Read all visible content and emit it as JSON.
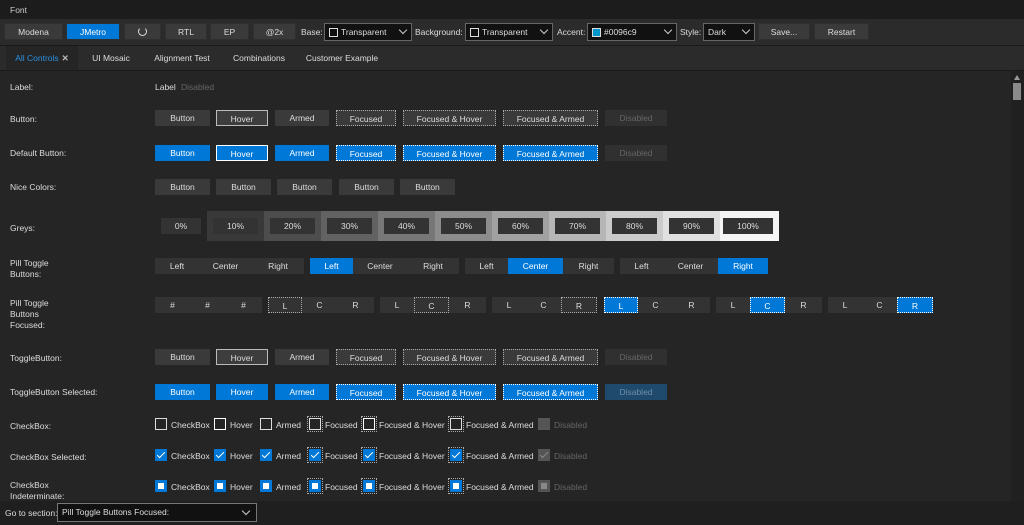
{
  "window": {
    "title": "Font"
  },
  "toolbar": {
    "modena": "Modena",
    "jmetro": "JMetro",
    "rtl": "RTL",
    "ep": "EP",
    "at2x": "@2x",
    "base_label": "Base:",
    "base_value": "Transparent",
    "background_label": "Background:",
    "background_value": "Transparent",
    "accent_label": "Accent:",
    "accent_value": "#0096c9",
    "accent_color": "#0096c9",
    "style_label": "Style:",
    "style_value": "Dark",
    "save": "Save...",
    "restart": "Restart"
  },
  "tabs": [
    "All Controls",
    "UI Mosaic",
    "Alignment Test",
    "Combinations",
    "Customer Example"
  ],
  "rows": {
    "label": {
      "title": "Label:",
      "items": [
        "Label",
        "Disabled"
      ]
    },
    "button": {
      "title": "Button:",
      "items": [
        "Button",
        "Hover",
        "Armed",
        "Focused",
        "Focused & Hover",
        "Focused & Armed",
        "Disabled"
      ]
    },
    "default_button": {
      "title": "Default Button:",
      "items": [
        "Button",
        "Hover",
        "Armed",
        "Focused",
        "Focused & Hover",
        "Focused & Armed",
        "Disabled"
      ]
    },
    "nice_colors": {
      "title": "Nice Colors:",
      "items": [
        "Button",
        "Button",
        "Button",
        "Button",
        "Button"
      ]
    },
    "greys": {
      "title": "Greys:",
      "items": [
        "0%",
        "10%",
        "20%",
        "30%",
        "40%",
        "50%",
        "60%",
        "70%",
        "80%",
        "90%",
        "100%"
      ]
    },
    "pill_toggle": {
      "title_lines": [
        "Pill Toggle",
        "Buttons:"
      ],
      "items": [
        "Left",
        "Center",
        "Right"
      ]
    },
    "pill_toggle_focused": {
      "title_lines": [
        "Pill Toggle",
        "Buttons",
        "Focused:"
      ],
      "groups": [
        [
          "#",
          "#",
          "#"
        ],
        [
          "L",
          "C",
          "R"
        ],
        [
          "L",
          "C",
          "R"
        ],
        [
          "L",
          "C",
          "R"
        ],
        [
          "L",
          "C",
          "R"
        ],
        [
          "L",
          "C",
          "R"
        ],
        [
          "L",
          "C",
          "R"
        ]
      ]
    },
    "toggle_button": {
      "title": "ToggleButton:",
      "items": [
        "Button",
        "Hover",
        "Armed",
        "Focused",
        "Focused & Hover",
        "Focused & Armed",
        "Disabled"
      ]
    },
    "toggle_button_selected": {
      "title": "ToggleButton Selected:",
      "items": [
        "Button",
        "Hover",
        "Armed",
        "Focused",
        "Focused & Hover",
        "Focused & Armed",
        "Disabled"
      ]
    },
    "checkbox": {
      "title": "CheckBox:",
      "items": [
        "CheckBox",
        "Hover",
        "Armed",
        "Focused",
        "Focused & Hover",
        "Focused & Armed",
        "Disabled"
      ]
    },
    "checkbox_selected": {
      "title": "CheckBox Selected:",
      "items": [
        "CheckBox",
        "Hover",
        "Armed",
        "Focused",
        "Focused & Hover",
        "Focused & Armed",
        "Disabled"
      ]
    },
    "checkbox_indeterminate": {
      "title_lines": [
        "CheckBox",
        "Indeterminate:"
      ],
      "items": [
        "CheckBox",
        "Hover",
        "Armed",
        "Focused",
        "Focused & Hover",
        "Focused & Armed",
        "Disabled"
      ]
    }
  },
  "footer": {
    "label": "Go to section:",
    "value": "Pill Toggle Buttons Focused:"
  }
}
